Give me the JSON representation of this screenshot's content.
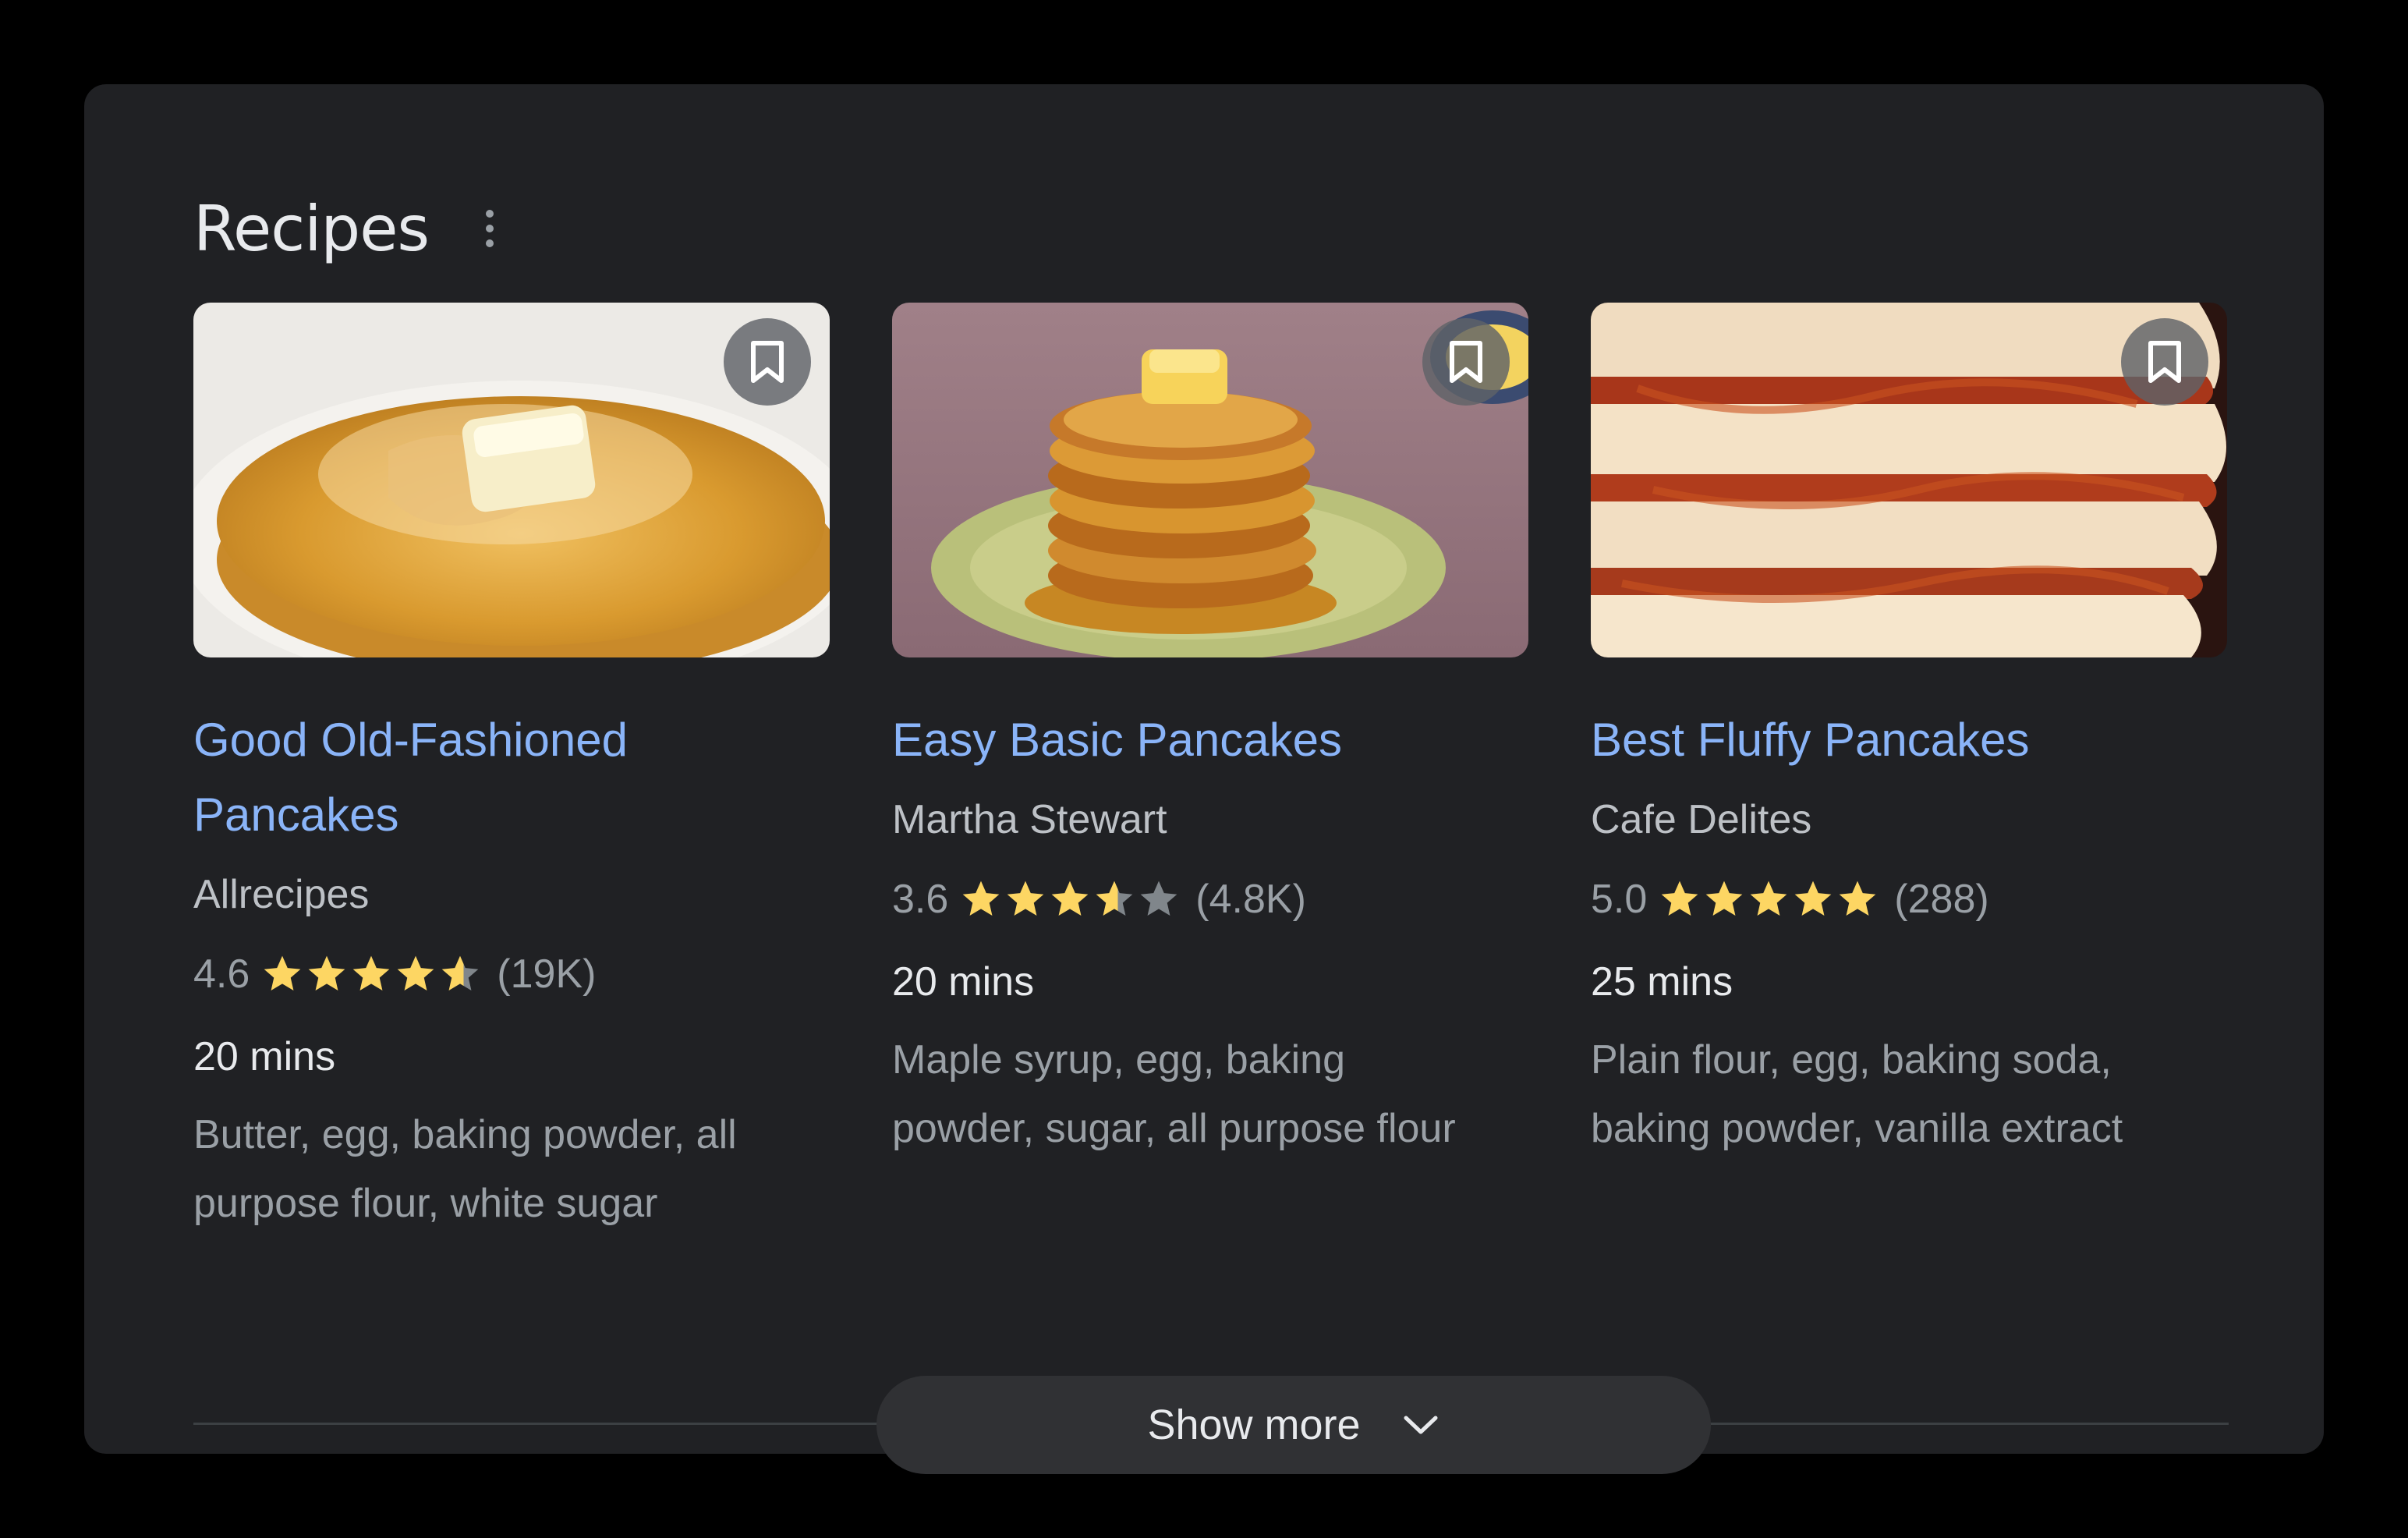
{
  "panel": {
    "title": "Recipes",
    "menu_icon": "more-vert-icon",
    "show_more_label": "Show more",
    "show_more_icon": "chevron-down-icon"
  },
  "colors": {
    "background": "#202124",
    "link": "#8ab4f8",
    "star": "#fdd663",
    "star_empty": "#80868b"
  },
  "recipes": [
    {
      "title_line1": "Good Old-Fashioned",
      "title_line2": "Pancakes",
      "source": "Allrecipes",
      "rating": "4.6",
      "rating_value": 4.6,
      "review_count": "(19K)",
      "time": "20 mins",
      "ingredients_line1": "Butter, egg, baking powder, all",
      "ingredients_line2": "purpose flour, white sugar",
      "image": "pancakes-with-butter-and-syrup",
      "save_icon": "bookmark-icon"
    },
    {
      "title_line1": "Easy Basic Pancakes",
      "source": "Martha Stewart",
      "rating": "3.6",
      "rating_value": 3.6,
      "review_count": "(4.8K)",
      "time": "20 mins",
      "ingredients_line1": "Maple syrup, egg, baking",
      "ingredients_line2": "powder, sugar, all purpose flour",
      "image": "pancake-stack-on-green-plate",
      "save_icon": "bookmark-icon"
    },
    {
      "title_line1": "Best Fluffy Pancakes",
      "source": "Cafe Delites",
      "rating": "5.0",
      "rating_value": 5.0,
      "review_count": "(288)",
      "time": "25 mins",
      "ingredients_line1": "Plain flour, egg, baking soda,",
      "ingredients_line2": "baking powder, vanilla extract",
      "image": "fluffy-pancake-stack-closeup",
      "save_icon": "bookmark-icon"
    }
  ]
}
